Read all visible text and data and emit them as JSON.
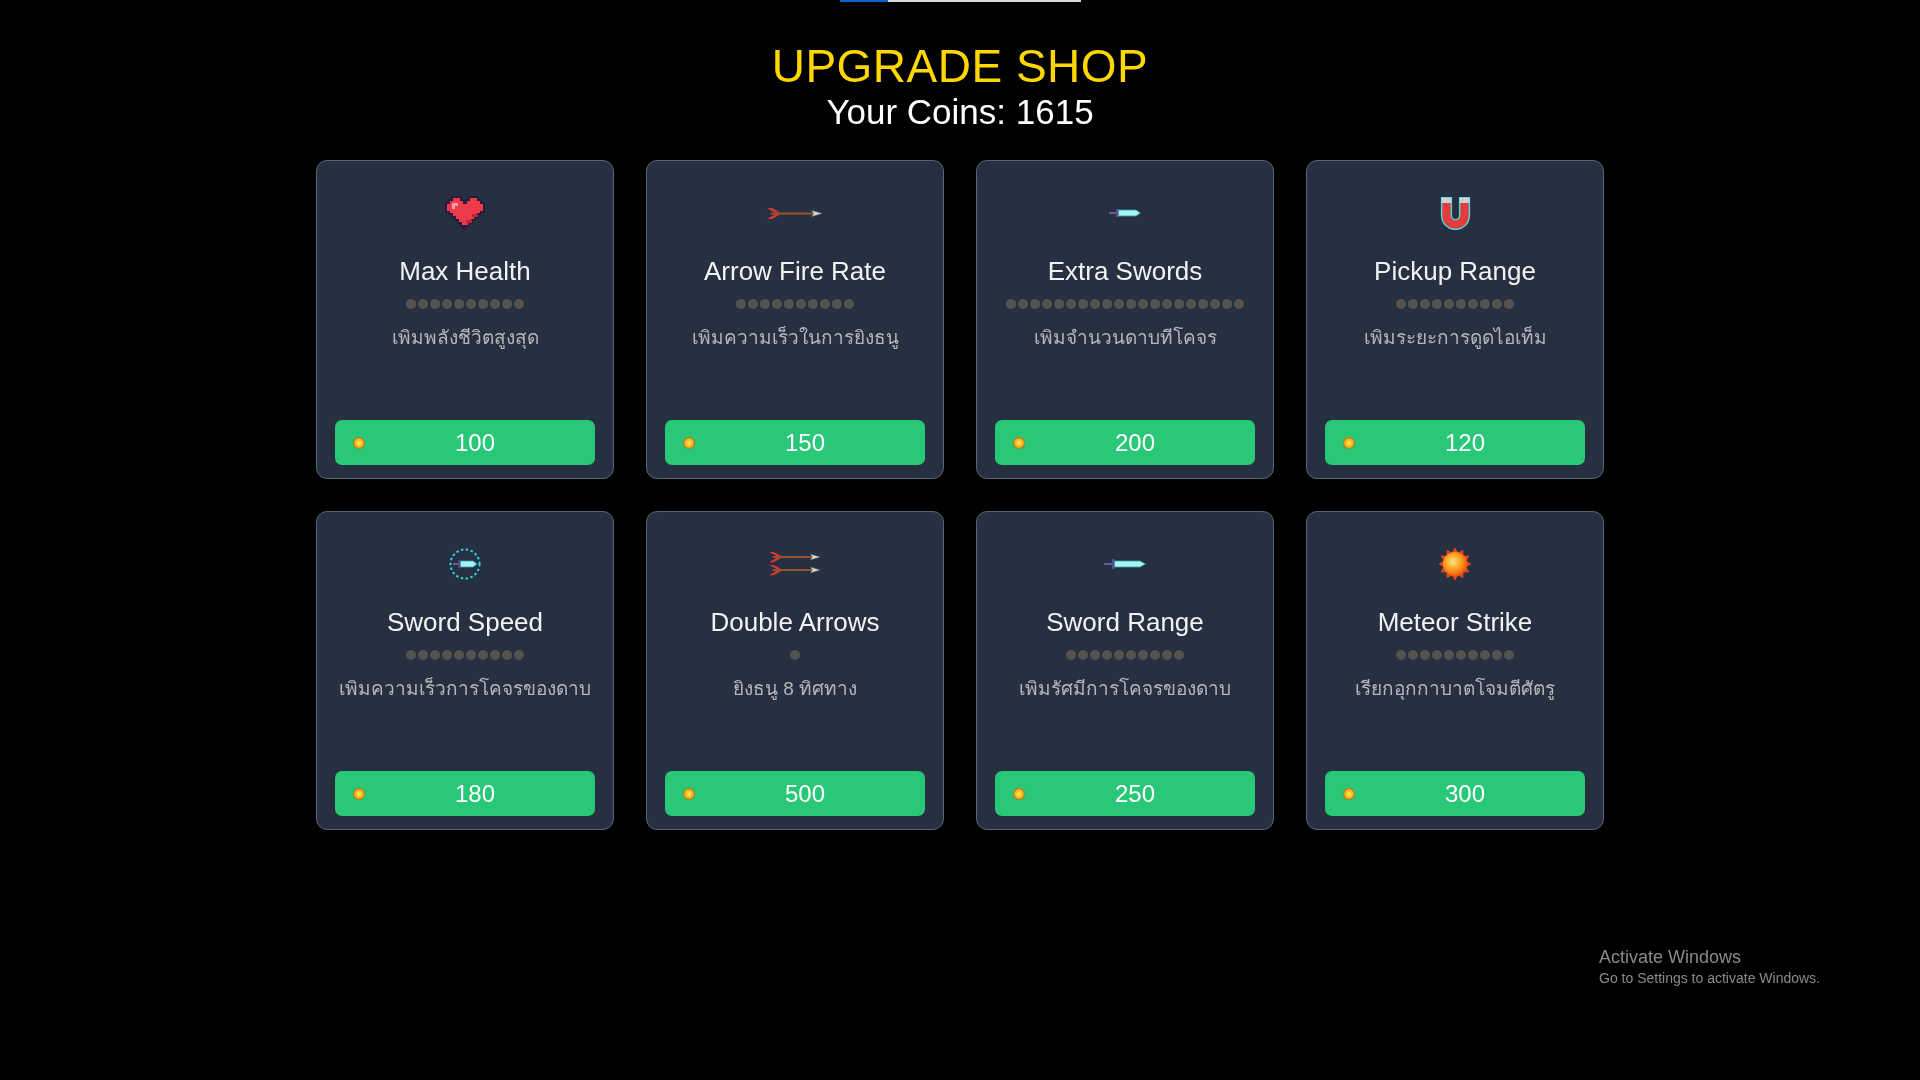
{
  "progress_bar": {
    "level": 0.2
  },
  "header": {
    "title": "UPGRADE SHOP",
    "coins": "Your Coins: 1615"
  },
  "upgrades": [
    {
      "kind": "health",
      "name": "Max Health",
      "pips": [
        {
          "filled": false
        },
        {
          "filled": false
        },
        {
          "filled": false
        },
        {
          "filled": false
        },
        {
          "filled": false
        },
        {
          "filled": false
        },
        {
          "filled": false
        },
        {
          "filled": false
        },
        {
          "filled": false
        },
        {
          "filled": false
        }
      ],
      "description": "เพิมพลังชีวิตสูงสุด",
      "price": "100"
    },
    {
      "kind": "firerate",
      "name": "Arrow Fire Rate",
      "pips": [
        {
          "filled": false
        },
        {
          "filled": false
        },
        {
          "filled": false
        },
        {
          "filled": false
        },
        {
          "filled": false
        },
        {
          "filled": false
        },
        {
          "filled": false
        },
        {
          "filled": false
        },
        {
          "filled": false
        },
        {
          "filled": false
        }
      ],
      "description": "เพิมความเร็วในการยิงธนู",
      "price": "150"
    },
    {
      "kind": "swords",
      "name": "Extra Swords",
      "pips": [
        {
          "filled": false
        },
        {
          "filled": false
        },
        {
          "filled": false
        },
        {
          "filled": false
        },
        {
          "filled": false
        },
        {
          "filled": false
        },
        {
          "filled": false
        },
        {
          "filled": false
        },
        {
          "filled": false
        },
        {
          "filled": false
        },
        {
          "filled": false
        },
        {
          "filled": false
        },
        {
          "filled": false
        },
        {
          "filled": false
        },
        {
          "filled": false
        },
        {
          "filled": false
        },
        {
          "filled": false
        },
        {
          "filled": false
        },
        {
          "filled": false
        },
        {
          "filled": false
        }
      ],
      "description": "เพิมจำนวนดาบทีโคจร",
      "price": "200"
    },
    {
      "kind": "pickup",
      "name": "Pickup Range",
      "pips": [
        {
          "filled": false
        },
        {
          "filled": false
        },
        {
          "filled": false
        },
        {
          "filled": false
        },
        {
          "filled": false
        },
        {
          "filled": false
        },
        {
          "filled": false
        },
        {
          "filled": false
        },
        {
          "filled": false
        },
        {
          "filled": false
        }
      ],
      "description": "เพิมระยะการดูดไอเท็ม",
      "price": "120"
    },
    {
      "kind": "swordspeed",
      "name": "Sword Speed",
      "pips": [
        {
          "filled": false
        },
        {
          "filled": false
        },
        {
          "filled": false
        },
        {
          "filled": false
        },
        {
          "filled": false
        },
        {
          "filled": false
        },
        {
          "filled": false
        },
        {
          "filled": false
        },
        {
          "filled": false
        },
        {
          "filled": false
        }
      ],
      "description": "เพิมความเร็วการโคจรของดาบ",
      "price": "180"
    },
    {
      "kind": "multishot",
      "name": "Double Arrows",
      "pips": [
        {
          "filled": false
        }
      ],
      "description": "ยิงธนู 8 ทิศทาง",
      "price": "500"
    },
    {
      "kind": "swordrange",
      "name": "Sword Range",
      "pips": [
        {
          "filled": false
        },
        {
          "filled": false
        },
        {
          "filled": false
        },
        {
          "filled": false
        },
        {
          "filled": false
        },
        {
          "filled": false
        },
        {
          "filled": false
        },
        {
          "filled": false
        },
        {
          "filled": false
        },
        {
          "filled": false
        }
      ],
      "description": "เพิมรัศมีการโคจรของดาบ",
      "price": "250"
    },
    {
      "kind": "meteor",
      "name": "Meteor Strike",
      "pips": [
        {
          "filled": false
        },
        {
          "filled": false
        },
        {
          "filled": false
        },
        {
          "filled": false
        },
        {
          "filled": false
        },
        {
          "filled": false
        },
        {
          "filled": false
        },
        {
          "filled": false
        },
        {
          "filled": false
        },
        {
          "filled": false
        }
      ],
      "description": "เรียกอุกกาบาตโจมตีศัตรู",
      "price": "300"
    }
  ],
  "os_notice": {
    "title": "Activate Windows",
    "text": "Go to Settings to activate Windows."
  }
}
